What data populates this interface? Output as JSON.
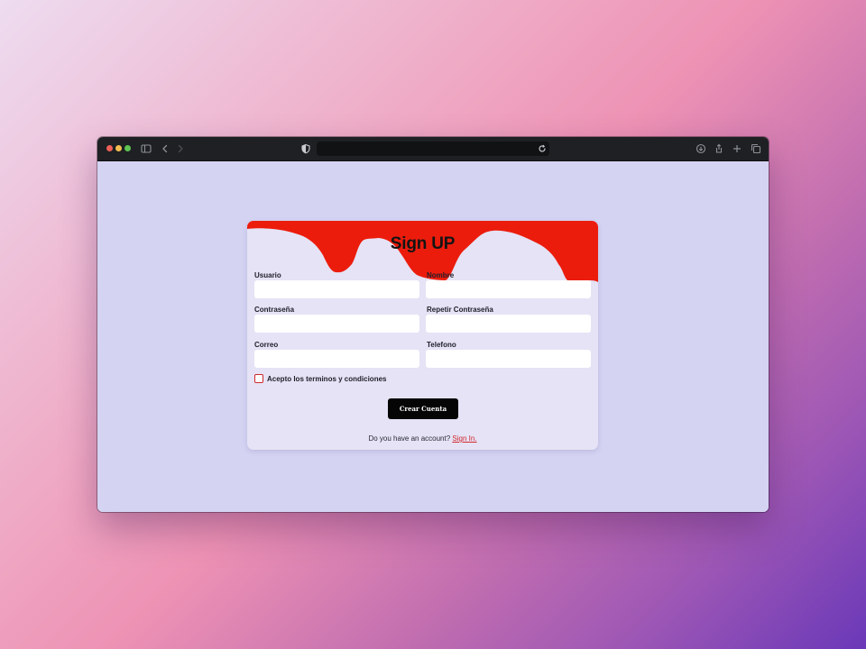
{
  "browser": {
    "url": "",
    "colors": {
      "chrome": "#1e2023",
      "close": "#ed5f57",
      "minimize": "#f4bd4f",
      "zoom": "#5fc453"
    },
    "icons": [
      "sidebar-icon",
      "back-icon",
      "forward-icon",
      "shield-icon",
      "reload-icon",
      "download-icon",
      "share-icon",
      "new-tab-icon",
      "tab-overview-icon"
    ]
  },
  "form": {
    "title": "Sign UP",
    "accent_color": "#ec1c0c",
    "fields": {
      "usuario": {
        "label": "Usuario",
        "value": "",
        "placeholder": ""
      },
      "nombre": {
        "label": "Nombre",
        "value": "",
        "placeholder": ""
      },
      "contrasena": {
        "label": "Contraseña",
        "value": "",
        "placeholder": ""
      },
      "repetir_contrasena": {
        "label": "Repetir Contraseña",
        "value": "",
        "placeholder": ""
      },
      "correo": {
        "label": "Correo",
        "value": "",
        "placeholder": ""
      },
      "telefono": {
        "label": "Telefono",
        "value": "",
        "placeholder": ""
      }
    },
    "terms": {
      "label": "Acepto los terminos y condiciones",
      "checked": false
    },
    "submit_label": "Crear Cuenta",
    "footer": {
      "text": "Do you have an account?",
      "link_label": "Sign In."
    }
  }
}
